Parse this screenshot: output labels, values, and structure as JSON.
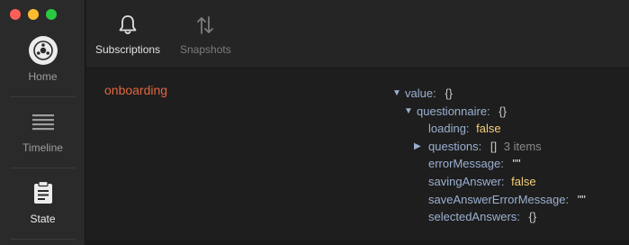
{
  "sidebar": {
    "items": [
      {
        "label": "Home",
        "icon": "reactotron-logo-icon"
      },
      {
        "label": "Timeline",
        "icon": "list-icon"
      },
      {
        "label": "State",
        "icon": "clipboard-icon",
        "active": true
      }
    ]
  },
  "toolbar": {
    "subscriptions_label": "Subscriptions",
    "snapshots_label": "Snapshots"
  },
  "subscription": {
    "path": "onboarding"
  },
  "tree": {
    "value_key": "value:",
    "value_type": "{}",
    "questionnaire_key": "questionnaire:",
    "questionnaire_type": "{}",
    "loading_key": "loading:",
    "loading_value": "false",
    "questions_key": "questions:",
    "questions_type": "[]",
    "questions_count": "3 items",
    "errorMessage_key": "errorMessage:",
    "errorMessage_value": "\"\"",
    "savingAnswer_key": "savingAnswer:",
    "savingAnswer_value": "false",
    "saveAnswerErrorMessage_key": "saveAnswerErrorMessage:",
    "saveAnswerErrorMessage_value": "\"\"",
    "selectedAnswers_key": "selectedAnswers:",
    "selectedAnswers_type": "{}"
  },
  "colors": {
    "accent_orange": "#e2663f",
    "key_blue": "#9bb0d1",
    "bool_yellow": "#f6cf76"
  }
}
